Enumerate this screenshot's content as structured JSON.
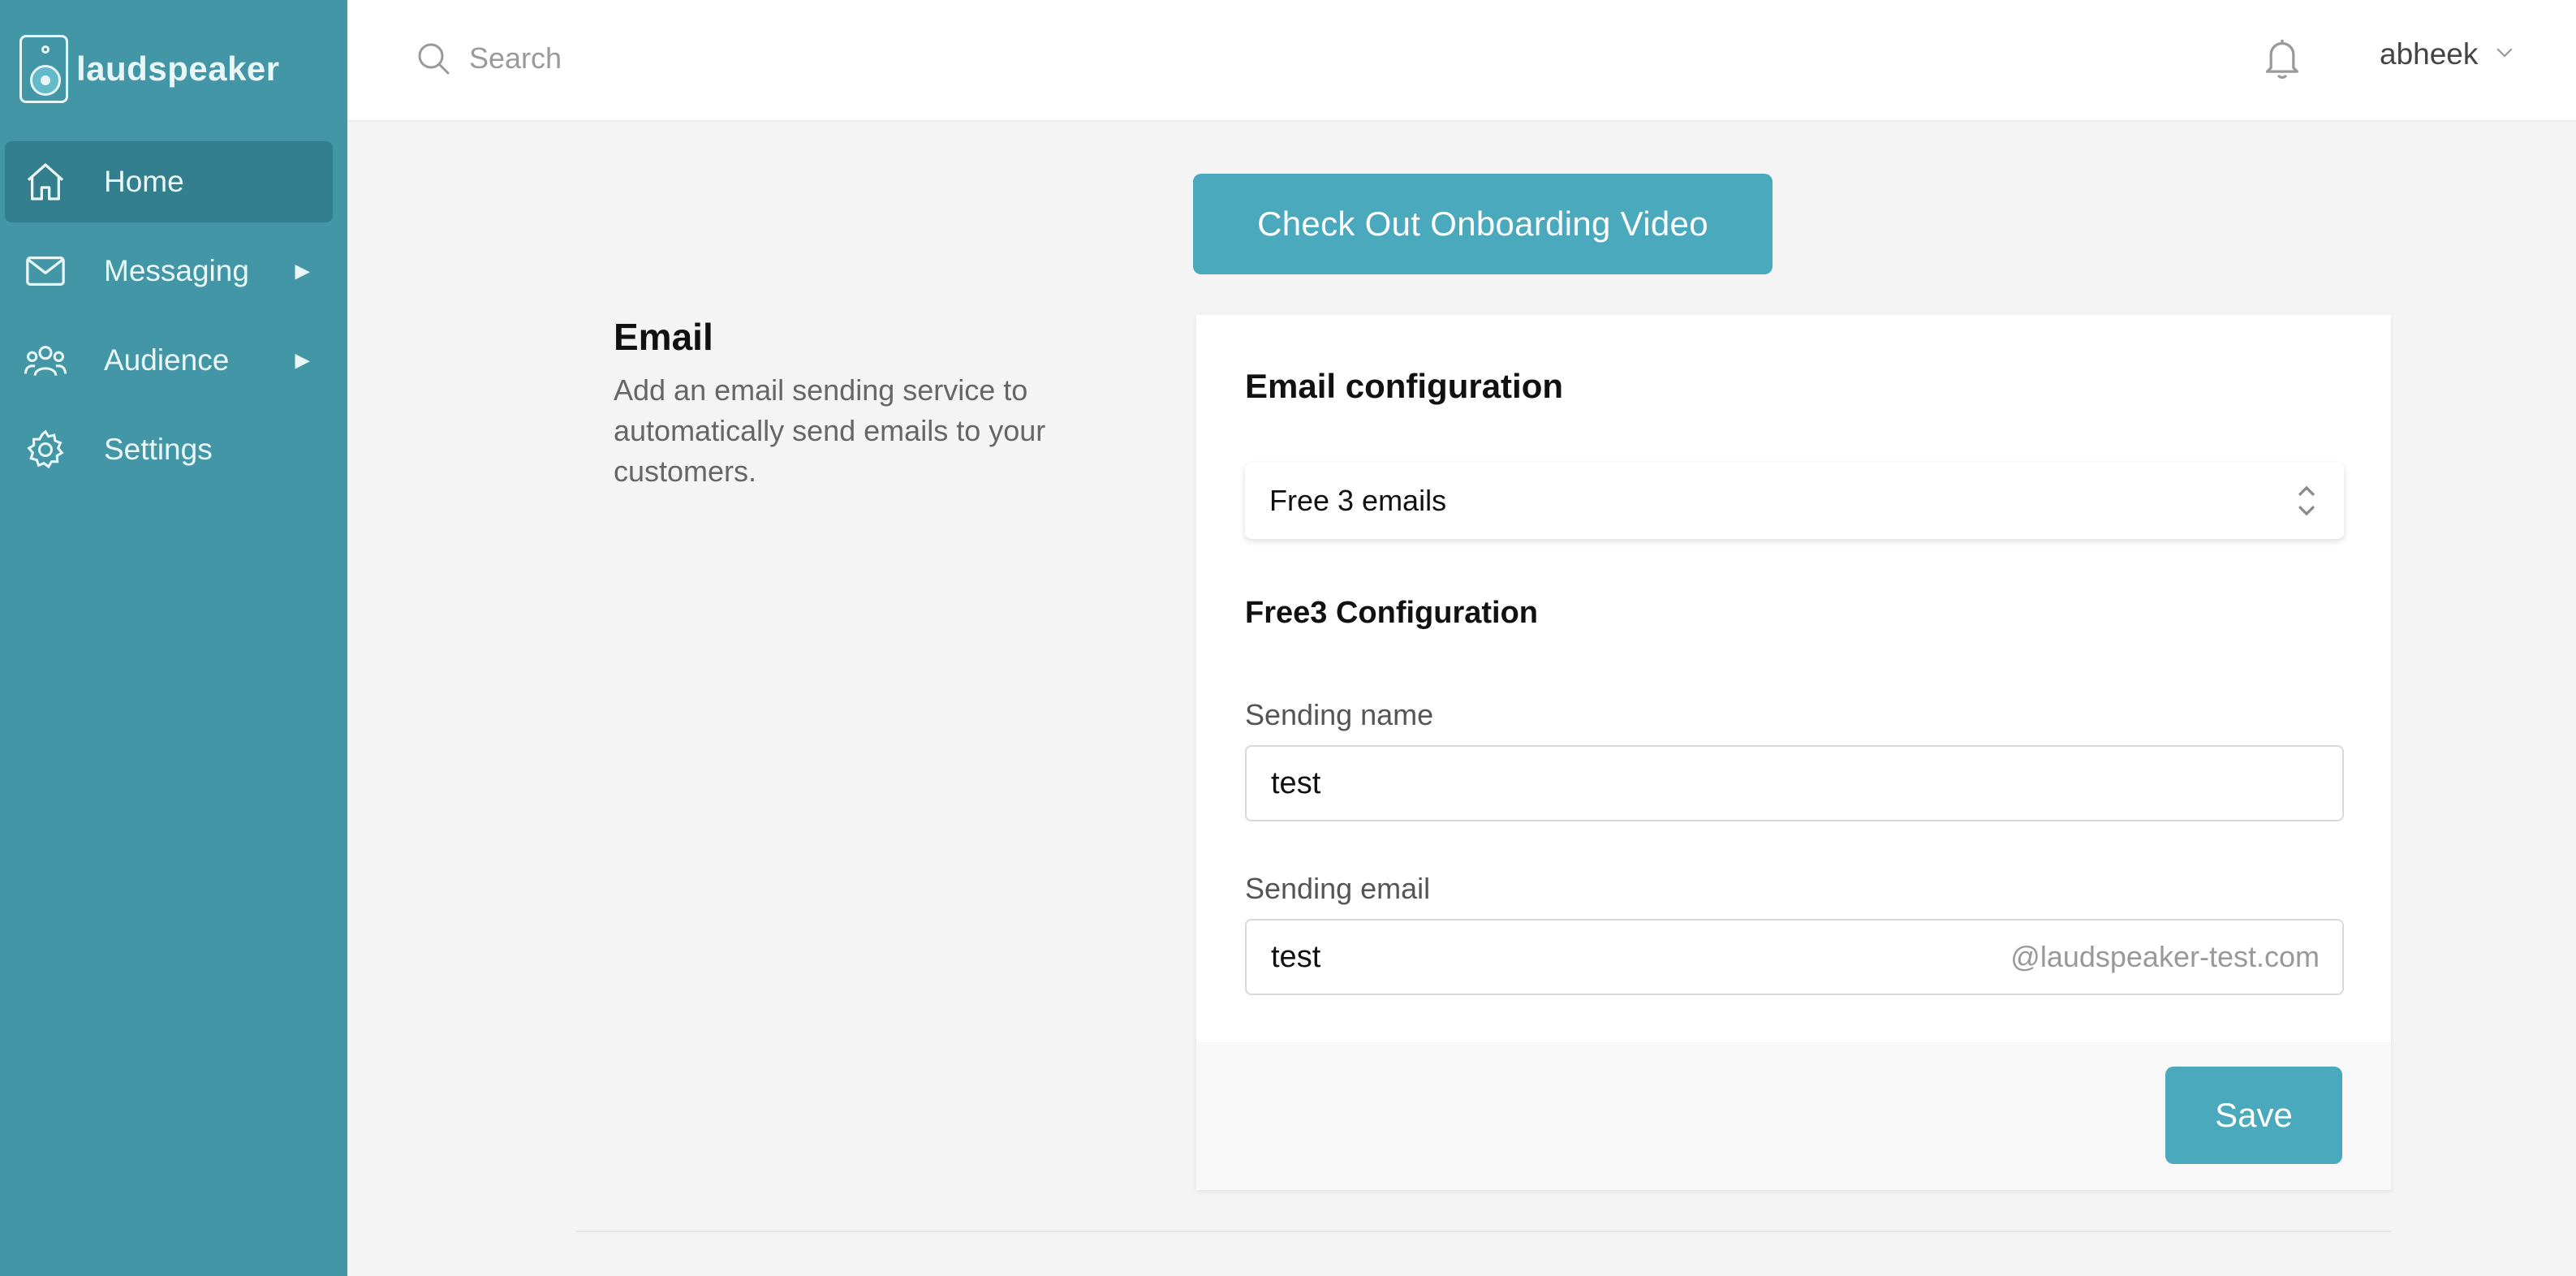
{
  "brand": {
    "name": "laudspeaker"
  },
  "sidebar": {
    "items": [
      {
        "label": "Home",
        "icon": "home-icon",
        "active": true,
        "has_submenu": false
      },
      {
        "label": "Messaging",
        "icon": "envelope-icon",
        "active": false,
        "has_submenu": true
      },
      {
        "label": "Audience",
        "icon": "people-icon",
        "active": false,
        "has_submenu": true
      },
      {
        "label": "Settings",
        "icon": "gear-icon",
        "active": false,
        "has_submenu": false
      }
    ],
    "submenu_arrow": "▶"
  },
  "header": {
    "search_placeholder": "Search",
    "user_name": "abheek"
  },
  "main": {
    "onboarding_button": "Check Out Onboarding Video",
    "section": {
      "title": "Email",
      "description": "Add an email sending service to automatically send emails to your customers."
    },
    "card": {
      "title": "Email configuration",
      "provider_select_value": "Free 3 emails",
      "config_title": "Free3 Configuration",
      "sending_name_label": "Sending name",
      "sending_name_value": "test",
      "sending_email_label": "Sending email",
      "sending_email_value": "test",
      "sending_email_suffix": "@laudspeaker-test.com",
      "save_label": "Save"
    }
  },
  "colors": {
    "sidebar_bg": "#4396a6",
    "sidebar_active": "#347f8e",
    "accent_button": "#4aa9bc"
  }
}
